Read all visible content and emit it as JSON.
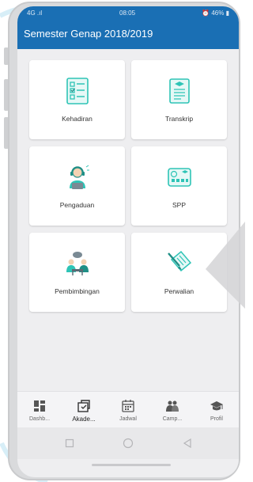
{
  "status_bar": {
    "signal": "4G .ıl",
    "time": "08:05",
    "battery": "46%"
  },
  "app_bar": {
    "title": "Semester Genap 2018/2019"
  },
  "menu": [
    {
      "label": "Kehadiran",
      "icon": "attendance-checklist-icon"
    },
    {
      "label": "Transkrip",
      "icon": "transcript-document-icon"
    },
    {
      "label": "Pengaduan",
      "icon": "complaint-headset-icon"
    },
    {
      "label": "SPP",
      "icon": "tuition-card-icon"
    },
    {
      "label": "Pembimbingan",
      "icon": "mentoring-people-icon"
    },
    {
      "label": "Perwalian",
      "icon": "advisory-document-icon"
    }
  ],
  "bottom_nav": [
    {
      "label": "Dashb...",
      "icon": "dashboard-icon",
      "active": false
    },
    {
      "label": "Akade...",
      "icon": "academic-icon",
      "active": true
    },
    {
      "label": "Jadwal",
      "icon": "calendar-icon",
      "active": false
    },
    {
      "label": "Camp...",
      "icon": "campus-icon",
      "active": false
    },
    {
      "label": "Profil",
      "icon": "graduation-cap-icon",
      "active": false
    }
  ],
  "colors": {
    "app_bar": "#1a6fb4",
    "accent_teal": "#2ec4b6",
    "background": "#eeeef0"
  }
}
